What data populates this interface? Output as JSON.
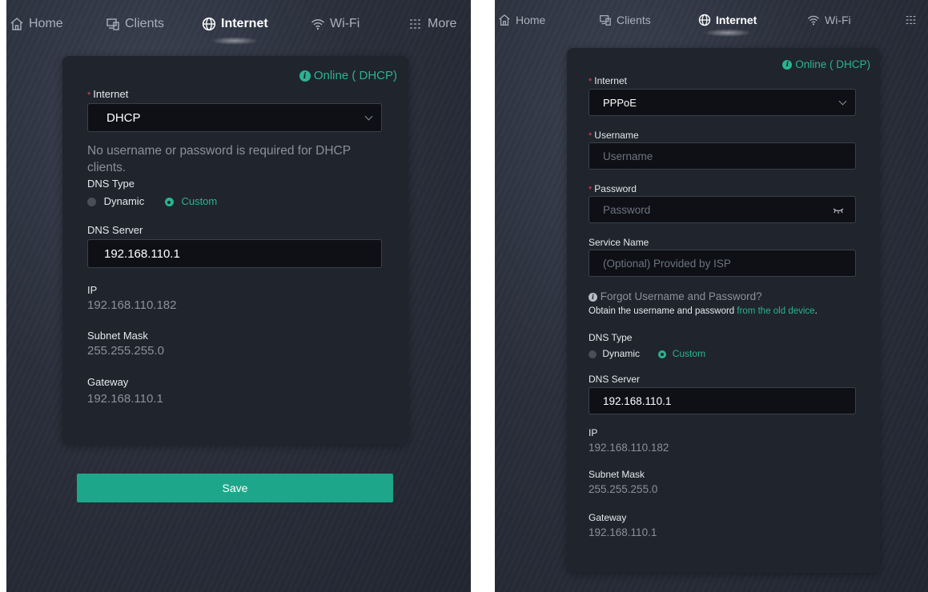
{
  "nav": {
    "home": "Home",
    "clients": "Clients",
    "internet": "Internet",
    "wifi": "Wi-Fi",
    "more": "More"
  },
  "status": "Online ( DHCP)",
  "left": {
    "internet_label": "Internet",
    "internet_value": "DHCP",
    "dhcp_note": "No username or password is required for DHCP clients.",
    "dns_type_label": "DNS Type",
    "dns_dynamic": "Dynamic",
    "dns_custom": "Custom",
    "dns_server_label": "DNS Server",
    "dns_server_value": "192.168.110.1",
    "ip_label": "IP",
    "ip_value": "192.168.110.182",
    "mask_label": "Subnet Mask",
    "mask_value": "255.255.255.0",
    "gateway_label": "Gateway",
    "gateway_value": "192.168.110.1",
    "save_label": "Save"
  },
  "right": {
    "internet_label": "Internet",
    "internet_value": "PPPoE",
    "username_label": "Username",
    "username_placeholder": "Username",
    "password_label": "Password",
    "password_placeholder": "Password",
    "service_label": "Service Name",
    "service_placeholder": "(Optional) Provided by ISP",
    "forgot_title": "Forgot Username and Password?",
    "forgot_text": "Obtain the username and password",
    "forgot_link": "from the old device",
    "forgot_end": ".",
    "dns_type_label": "DNS Type",
    "dns_dynamic": "Dynamic",
    "dns_custom": "Custom",
    "dns_server_label": "DNS Server",
    "dns_server_value": "192.168.110.1",
    "ip_label": "IP",
    "ip_value": "192.168.110.182",
    "mask_label": "Subnet Mask",
    "mask_value": "255.255.255.0",
    "gateway_label": "Gateway",
    "gateway_value": "192.168.110.1"
  },
  "colors": {
    "accent": "#2ab392",
    "required": "#e54848",
    "card": "#20242d"
  },
  "icons": [
    "home-icon",
    "clients-icon",
    "globe-icon",
    "wifi-icon",
    "more-icon",
    "info-icon",
    "eye-closed-icon",
    "chevron-down-icon"
  ]
}
